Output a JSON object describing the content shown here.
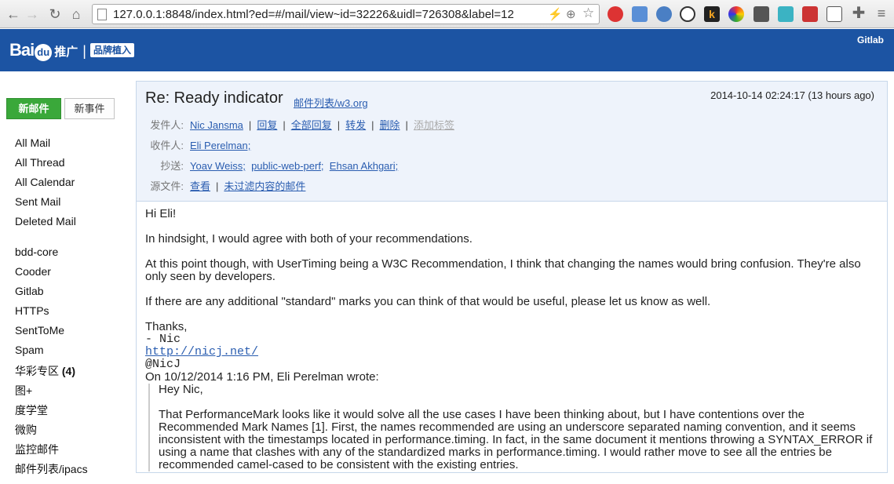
{
  "browser": {
    "url": "127.0.0.1:8848/index.html?ed=#/mail/view~id=32226&uidl=726308&label=12"
  },
  "header": {
    "logo_main": "Bai",
    "logo_du": "du",
    "logo_promo": "推广",
    "logo_sep": "|",
    "logo_tag": "品牌植入",
    "gitlab": "Gitlab"
  },
  "sidebar": {
    "new_mail": "新邮件",
    "new_event": "新事件",
    "primary": [
      "All Mail",
      "All Thread",
      "All Calendar",
      "Sent Mail",
      "Deleted Mail"
    ],
    "labels": [
      "bdd-core",
      "Cooder",
      "Gitlab",
      "HTTPs",
      "SentToMe",
      "Spam",
      "华彩专区",
      "图+",
      "度学堂",
      "微购",
      "监控邮件",
      "邮件列表/ipacs"
    ],
    "huacai_count": "(4)"
  },
  "mail": {
    "subject": "Re: Ready indicator",
    "list": "邮件列表/w3.org",
    "date": "2014-10-14 02:24:17 (13 hours ago)",
    "from_label": "发件人:",
    "from": "Nic Jansma",
    "reply": "回复",
    "reply_all": "全部回复",
    "forward": "转发",
    "delete": "删除",
    "add_tag": "添加标签",
    "to_label": "收件人:",
    "to": "Eli Perelman;",
    "cc_label": "抄送:",
    "cc": [
      "Yoav Weiss;",
      "public-web-perf;",
      "Ehsan Akhgari;"
    ],
    "source_label": "源文件:",
    "view": "查看",
    "unfiltered": "未过滤内容的邮件",
    "body": {
      "greeting": "Hi Eli!",
      "p1": "In hindsight, I would agree with both of your recommendations.",
      "p2": "At this point though, with UserTiming being a W3C Recommendation, I think that changing the names would bring confusion. They're also only seen by developers.",
      "p3": "If there are any additional \"standard\" marks you can think of that would be useful, please let us know as well.",
      "thanks": "Thanks,",
      "sig_name": "- Nic",
      "sig_url": "http://nicj.net/",
      "sig_handle": "@NicJ",
      "quote_intro": "On 10/12/2014 1:16 PM, Eli Perelman wrote:",
      "quote_greeting": "Hey Nic,",
      "quote_p1": "That PerformanceMark looks like it would solve all the use cases I have been thinking about, but I have contentions over the Recommended Mark Names [1]. First, the names recommended are using an underscore separated naming convention, and it seems inconsistent with the timestamps located in performance.timing. In fact, in the same document it mentions throwing a SYNTAX_ERROR if using a name that clashes with any of the standardized marks in performance.timing. I would rather move to see all the entries be recommended camel-cased to be consistent with the existing entries."
    }
  }
}
